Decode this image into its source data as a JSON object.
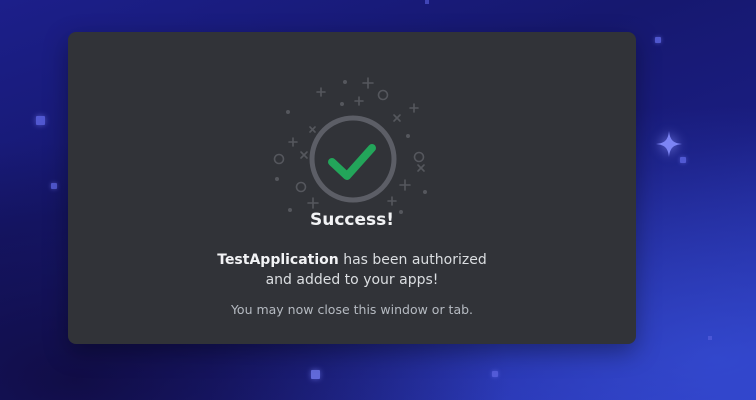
{
  "dialog": {
    "title": "Success!",
    "app_name": "TestApplication",
    "message_line1_rest": " has been authorized",
    "message_line2": "and added to your apps!",
    "note": "You may now close this window or tab."
  },
  "icons": {
    "status": "checkmark-icon"
  },
  "colors": {
    "card_background": "#313338",
    "checkmark": "#23a55a",
    "ring": "#5c5e66",
    "background_accent": "#5b63e0"
  }
}
